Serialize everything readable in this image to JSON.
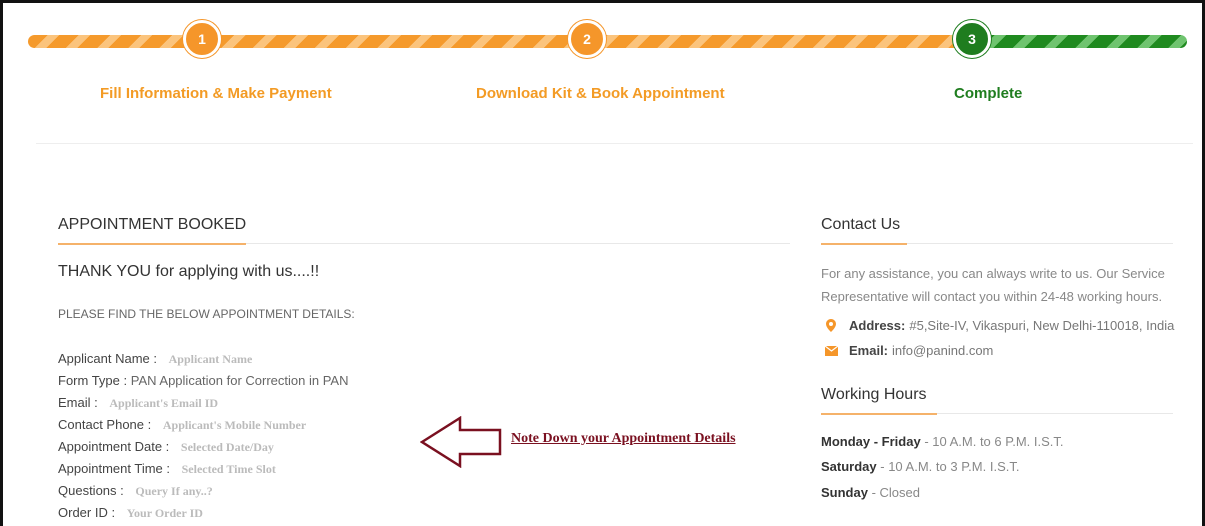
{
  "steps": [
    {
      "number": "1",
      "label": "Fill Information & Make Payment"
    },
    {
      "number": "2",
      "label": "Download Kit & Book Appointment"
    },
    {
      "number": "3",
      "label": "Complete"
    }
  ],
  "colors": {
    "progress_done": "#f5962a",
    "progress_complete": "#1f7d1f",
    "note": "#7a1020"
  },
  "appointment": {
    "title": "APPOINTMENT BOOKED",
    "thanks": "THANK YOU for applying with us....!!",
    "intro": "PLEASE FIND THE BELOW APPOINTMENT DETAILS:",
    "fields": [
      {
        "key": "Applicant Name :",
        "value": "",
        "placeholder": "Applicant Name"
      },
      {
        "key": "Form Type :",
        "value": "PAN Application for Correction in PAN",
        "placeholder": ""
      },
      {
        "key": "Email :",
        "value": "",
        "placeholder": "Applicant's Email ID"
      },
      {
        "key": "Contact Phone :",
        "value": "",
        "placeholder": "Applicant's Mobile Number"
      },
      {
        "key": "Appointment Date :",
        "value": "",
        "placeholder": "Selected Date/Day"
      },
      {
        "key": "Appointment Time :",
        "value": "",
        "placeholder": "Selected Time Slot"
      },
      {
        "key": "Questions :",
        "value": "",
        "placeholder": "Query If any..?"
      },
      {
        "key": "Order ID :",
        "value": "",
        "placeholder": "Your Order ID"
      }
    ],
    "note": "Note Down your Appointment Details"
  },
  "contact": {
    "title": "Contact Us",
    "text": "For any assistance, you can always write to us. Our Service Representative will contact you within 24-48 working hours.",
    "address_label": "Address:",
    "address": "#5,Site-IV, Vikaspuri, New Delhi-110018, India",
    "email_label": "Email:",
    "email": "info@panind.com",
    "address_icon": "map-pin-icon",
    "email_icon": "envelope-icon"
  },
  "hours": {
    "title": "Working Hours",
    "rows": [
      {
        "day": "Monday - Friday",
        "time": "- 10 A.M. to 6 P.M. I.S.T."
      },
      {
        "day": "Saturday",
        "time": "- 10 A.M. to 3 P.M. I.S.T."
      },
      {
        "day": "Sunday",
        "time": "- Closed"
      }
    ]
  }
}
